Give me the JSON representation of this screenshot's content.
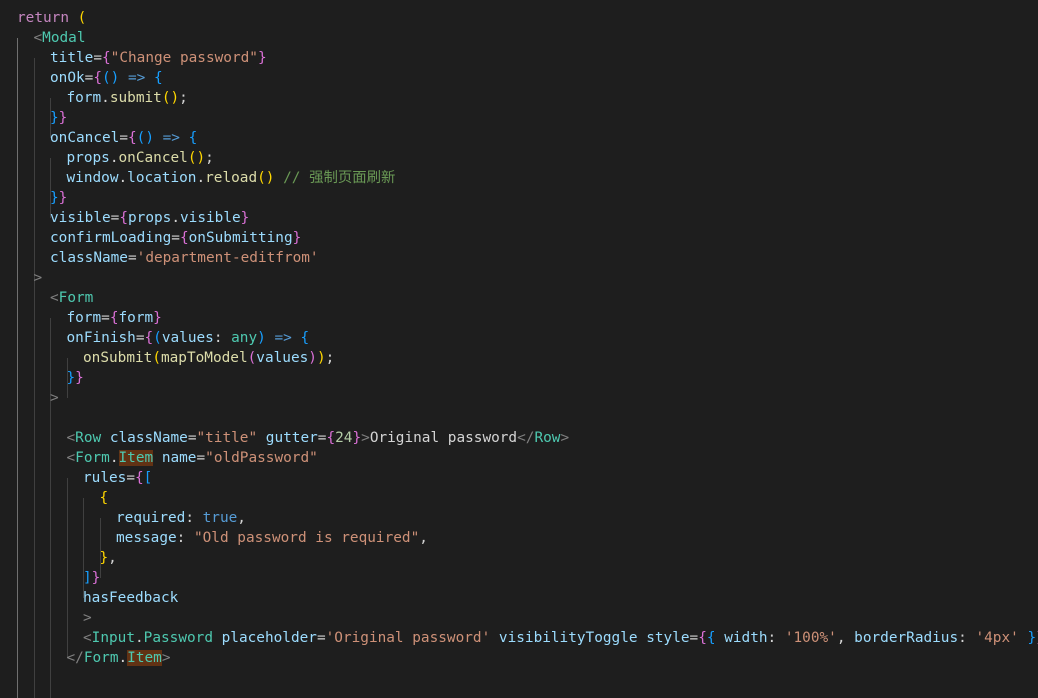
{
  "editor": {
    "language": "tsx",
    "theme": "dark",
    "lines": [
      [
        [
          "return ",
          "t-kw"
        ],
        [
          "(",
          "b1"
        ]
      ],
      [
        [
          "<",
          "t-pun"
        ],
        [
          "Modal",
          "t-tag"
        ]
      ],
      [
        [
          "title",
          "t-attr"
        ],
        [
          "=",
          "t-txt"
        ],
        [
          "{",
          "b2"
        ],
        [
          "\"Change password\"",
          "t-str"
        ],
        [
          "}",
          "b2"
        ]
      ],
      [
        [
          "onOk",
          "t-attr"
        ],
        [
          "=",
          "t-txt"
        ],
        [
          "{",
          "b2"
        ],
        [
          "()",
          "b3"
        ],
        [
          " => ",
          "t-op"
        ],
        [
          "{",
          "b3"
        ]
      ],
      [
        [
          "form",
          "t-var"
        ],
        [
          ".",
          "t-txt"
        ],
        [
          "submit",
          "t-fn"
        ],
        [
          "()",
          "b1"
        ],
        [
          ";",
          "t-txt"
        ]
      ],
      [
        [
          "}",
          "b3"
        ],
        [
          "}",
          "b2"
        ]
      ],
      [
        [
          "onCancel",
          "t-attr"
        ],
        [
          "=",
          "t-txt"
        ],
        [
          "{",
          "b2"
        ],
        [
          "()",
          "b3"
        ],
        [
          " => ",
          "t-op"
        ],
        [
          "{",
          "b3"
        ]
      ],
      [
        [
          "props",
          "t-var"
        ],
        [
          ".",
          "t-txt"
        ],
        [
          "onCancel",
          "t-fn"
        ],
        [
          "()",
          "b1"
        ],
        [
          ";",
          "t-txt"
        ]
      ],
      [
        [
          "window",
          "t-var"
        ],
        [
          ".",
          "t-txt"
        ],
        [
          "location",
          "t-var"
        ],
        [
          ".",
          "t-txt"
        ],
        [
          "reload",
          "t-fn"
        ],
        [
          "()",
          "b1"
        ],
        [
          " // 强制页面刷新",
          "t-cmt"
        ]
      ],
      [
        [
          "}",
          "b3"
        ],
        [
          "}",
          "b2"
        ]
      ],
      [
        [
          "visible",
          "t-attr"
        ],
        [
          "=",
          "t-txt"
        ],
        [
          "{",
          "b2"
        ],
        [
          "props",
          "t-var"
        ],
        [
          ".",
          "t-txt"
        ],
        [
          "visible",
          "t-var"
        ],
        [
          "}",
          "b2"
        ]
      ],
      [
        [
          "confirmLoading",
          "t-attr"
        ],
        [
          "=",
          "t-txt"
        ],
        [
          "{",
          "b2"
        ],
        [
          "onSubmitting",
          "t-var"
        ],
        [
          "}",
          "b2"
        ]
      ],
      [
        [
          "className",
          "t-attr"
        ],
        [
          "=",
          "t-txt"
        ],
        [
          "'department-editfrom'",
          "t-str"
        ]
      ],
      [
        [
          ">",
          "t-pun"
        ]
      ],
      [
        [
          "<",
          "t-pun"
        ],
        [
          "Form",
          "t-tag"
        ]
      ],
      [
        [
          "form",
          "t-attr"
        ],
        [
          "=",
          "t-txt"
        ],
        [
          "{",
          "b2"
        ],
        [
          "form",
          "t-var"
        ],
        [
          "}",
          "b2"
        ]
      ],
      [
        [
          "onFinish",
          "t-attr"
        ],
        [
          "=",
          "t-txt"
        ],
        [
          "{",
          "b2"
        ],
        [
          "(",
          "b3"
        ],
        [
          "values",
          "t-var"
        ],
        [
          ": ",
          "t-txt"
        ],
        [
          "any",
          "t-type"
        ],
        [
          ")",
          "b3"
        ],
        [
          " => ",
          "t-op"
        ],
        [
          "{",
          "b3"
        ]
      ],
      [
        [
          "onSubmit",
          "t-fn"
        ],
        [
          "(",
          "b1"
        ],
        [
          "mapToModel",
          "t-fn"
        ],
        [
          "(",
          "b2"
        ],
        [
          "values",
          "t-var"
        ],
        [
          ")",
          "b2"
        ],
        [
          ")",
          "b1"
        ],
        [
          ";",
          "t-txt"
        ]
      ],
      [
        [
          "}",
          "b3"
        ],
        [
          "}",
          "b2"
        ]
      ],
      [
        [
          ">",
          "t-pun"
        ]
      ],
      [],
      [
        [
          "<",
          "t-pun"
        ],
        [
          "Row",
          "t-tag"
        ],
        [
          " className",
          "t-attr"
        ],
        [
          "=",
          "t-txt"
        ],
        [
          "\"title\"",
          "t-str"
        ],
        [
          " gutter",
          "t-attr"
        ],
        [
          "=",
          "t-txt"
        ],
        [
          "{",
          "b2"
        ],
        [
          "24",
          "t-num"
        ],
        [
          "}",
          "b2"
        ],
        [
          ">",
          "t-pun"
        ],
        [
          "Original password",
          "t-txt"
        ],
        [
          "</",
          "t-pun"
        ],
        [
          "Row",
          "t-tag"
        ],
        [
          ">",
          "t-pun"
        ]
      ],
      [
        [
          "<",
          "t-pun"
        ],
        [
          "Form",
          "t-tag"
        ],
        [
          ".",
          "t-txt"
        ],
        [
          "Item",
          "t-tag hl-item"
        ],
        [
          " name",
          "t-attr"
        ],
        [
          "=",
          "t-txt"
        ],
        [
          "\"oldPassword\"",
          "t-str"
        ]
      ],
      [
        [
          "rules",
          "t-attr"
        ],
        [
          "=",
          "t-txt"
        ],
        [
          "{",
          "b2"
        ],
        [
          "[",
          "b3"
        ]
      ],
      [
        [
          "{",
          "b1"
        ]
      ],
      [
        [
          "required",
          "t-attr"
        ],
        [
          ": ",
          "t-txt"
        ],
        [
          "true",
          "t-bool"
        ],
        [
          ",",
          "t-txt"
        ]
      ],
      [
        [
          "message",
          "t-attr"
        ],
        [
          ": ",
          "t-txt"
        ],
        [
          "\"Old password is required\"",
          "t-str"
        ],
        [
          ",",
          "t-txt"
        ]
      ],
      [
        [
          "}",
          "b1"
        ],
        [
          ",",
          "t-txt"
        ]
      ],
      [
        [
          "]",
          "b3"
        ],
        [
          "}",
          "b2"
        ]
      ],
      [
        [
          "hasFeedback",
          "t-attr"
        ]
      ],
      [
        [
          ">",
          "t-pun"
        ]
      ],
      [
        [
          "<",
          "t-pun"
        ],
        [
          "Input",
          "t-tag"
        ],
        [
          ".",
          "t-txt"
        ],
        [
          "Password",
          "t-tag"
        ],
        [
          " placeholder",
          "t-attr"
        ],
        [
          "=",
          "t-txt"
        ],
        [
          "'Original password'",
          "t-str"
        ],
        [
          " visibilityToggle",
          "t-attr"
        ],
        [
          " style",
          "t-attr"
        ],
        [
          "=",
          "t-txt"
        ],
        [
          "{",
          "b2"
        ],
        [
          "{",
          "b3"
        ],
        [
          " width",
          "t-attr"
        ],
        [
          ": ",
          "t-txt"
        ],
        [
          "'100%'",
          "t-str"
        ],
        [
          ", ",
          "t-txt"
        ],
        [
          "borderRadius",
          "t-attr"
        ],
        [
          ": ",
          "t-txt"
        ],
        [
          "'4px'",
          "t-str"
        ],
        [
          " ",
          "t-txt"
        ],
        [
          "}",
          "b3"
        ],
        [
          "}",
          "b2"
        ],
        [
          " />",
          "t-pun"
        ]
      ],
      [
        [
          "</",
          "t-pun"
        ],
        [
          "Form",
          "t-tag"
        ],
        [
          ".",
          "t-txt"
        ],
        [
          "Item",
          "t-tag hl-item"
        ],
        [
          ">",
          "t-pun"
        ]
      ]
    ]
  }
}
